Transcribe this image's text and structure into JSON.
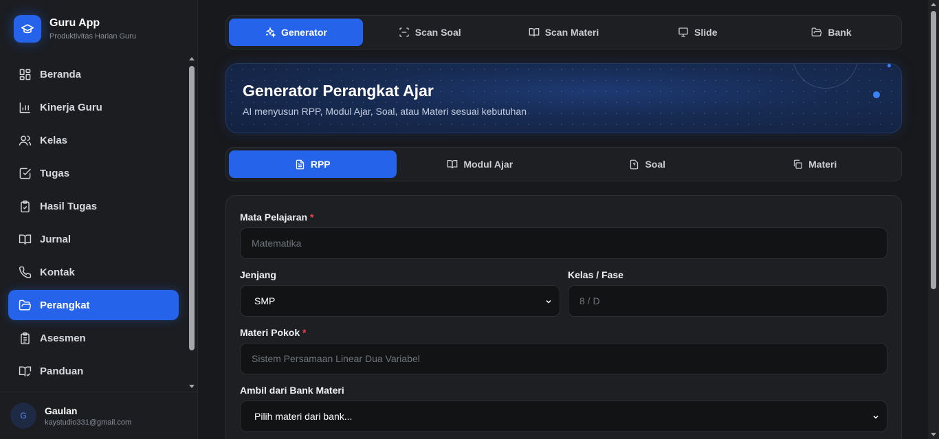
{
  "app": {
    "title": "Guru App",
    "subtitle": "Produktivitas Harian Guru"
  },
  "sidebar": {
    "items": [
      {
        "label": "Beranda",
        "icon": "grid-icon"
      },
      {
        "label": "Kinerja Guru",
        "icon": "bar-chart-icon"
      },
      {
        "label": "Kelas",
        "icon": "users-icon"
      },
      {
        "label": "Tugas",
        "icon": "checkbox-icon"
      },
      {
        "label": "Hasil Tugas",
        "icon": "clipboard-check-icon"
      },
      {
        "label": "Jurnal",
        "icon": "book-open-icon"
      },
      {
        "label": "Kontak",
        "icon": "phone-icon"
      },
      {
        "label": "Perangkat",
        "icon": "folder-open-icon",
        "active": true
      },
      {
        "label": "Asesmen",
        "icon": "clipboard-list-icon"
      },
      {
        "label": "Panduan",
        "icon": "book-check-icon"
      }
    ]
  },
  "user": {
    "initial": "G",
    "name": "Gaulan",
    "email": "kaystudio331@gmail.com"
  },
  "top_tabs": [
    {
      "label": "Generator",
      "icon": "sparkles-icon",
      "active": true
    },
    {
      "label": "Scan Soal",
      "icon": "scan-icon"
    },
    {
      "label": "Scan Materi",
      "icon": "book-open-icon"
    },
    {
      "label": "Slide",
      "icon": "presentation-icon"
    },
    {
      "label": "Bank",
      "icon": "folder-icon"
    }
  ],
  "hero": {
    "title": "Generator Perangkat Ajar",
    "subtitle": "AI menyusun RPP, Modul Ajar, Soal, atau Materi sesuai kebutuhan"
  },
  "sub_tabs": [
    {
      "label": "RPP",
      "icon": "file-text-icon",
      "active": true
    },
    {
      "label": "Modul Ajar",
      "icon": "book-open-icon"
    },
    {
      "label": "Soal",
      "icon": "file-question-icon"
    },
    {
      "label": "Materi",
      "icon": "copy-icon"
    }
  ],
  "form": {
    "mata_pelajaran": {
      "label": "Mata Pelajaran",
      "required": "*",
      "placeholder": "Matematika"
    },
    "jenjang": {
      "label": "Jenjang",
      "value": "SMP"
    },
    "kelas": {
      "label": "Kelas / Fase",
      "placeholder": "8 / D"
    },
    "materi_pokok": {
      "label": "Materi Pokok",
      "required": "*",
      "placeholder": "Sistem Persamaan Linear Dua Variabel"
    },
    "bank_materi": {
      "label": "Ambil dari Bank Materi",
      "value": "Pilih materi dari bank..."
    }
  },
  "colors": {
    "accent": "#2563eb",
    "required": "#ef4444"
  }
}
